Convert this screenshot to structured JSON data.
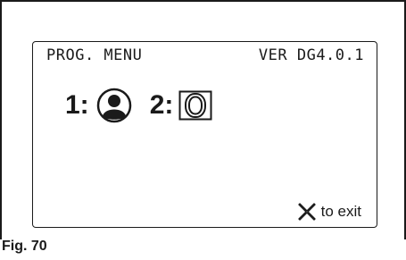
{
  "display": {
    "menu_title": "PROG. MENU",
    "version": "VER DG4.0.1",
    "options": [
      {
        "label": "1:",
        "icon": "person-icon"
      },
      {
        "label": "2:",
        "icon": "tray-icon"
      }
    ],
    "exit_hint": {
      "icon": "cross-icon",
      "text": "to exit"
    }
  },
  "caption": "Fig. 70"
}
